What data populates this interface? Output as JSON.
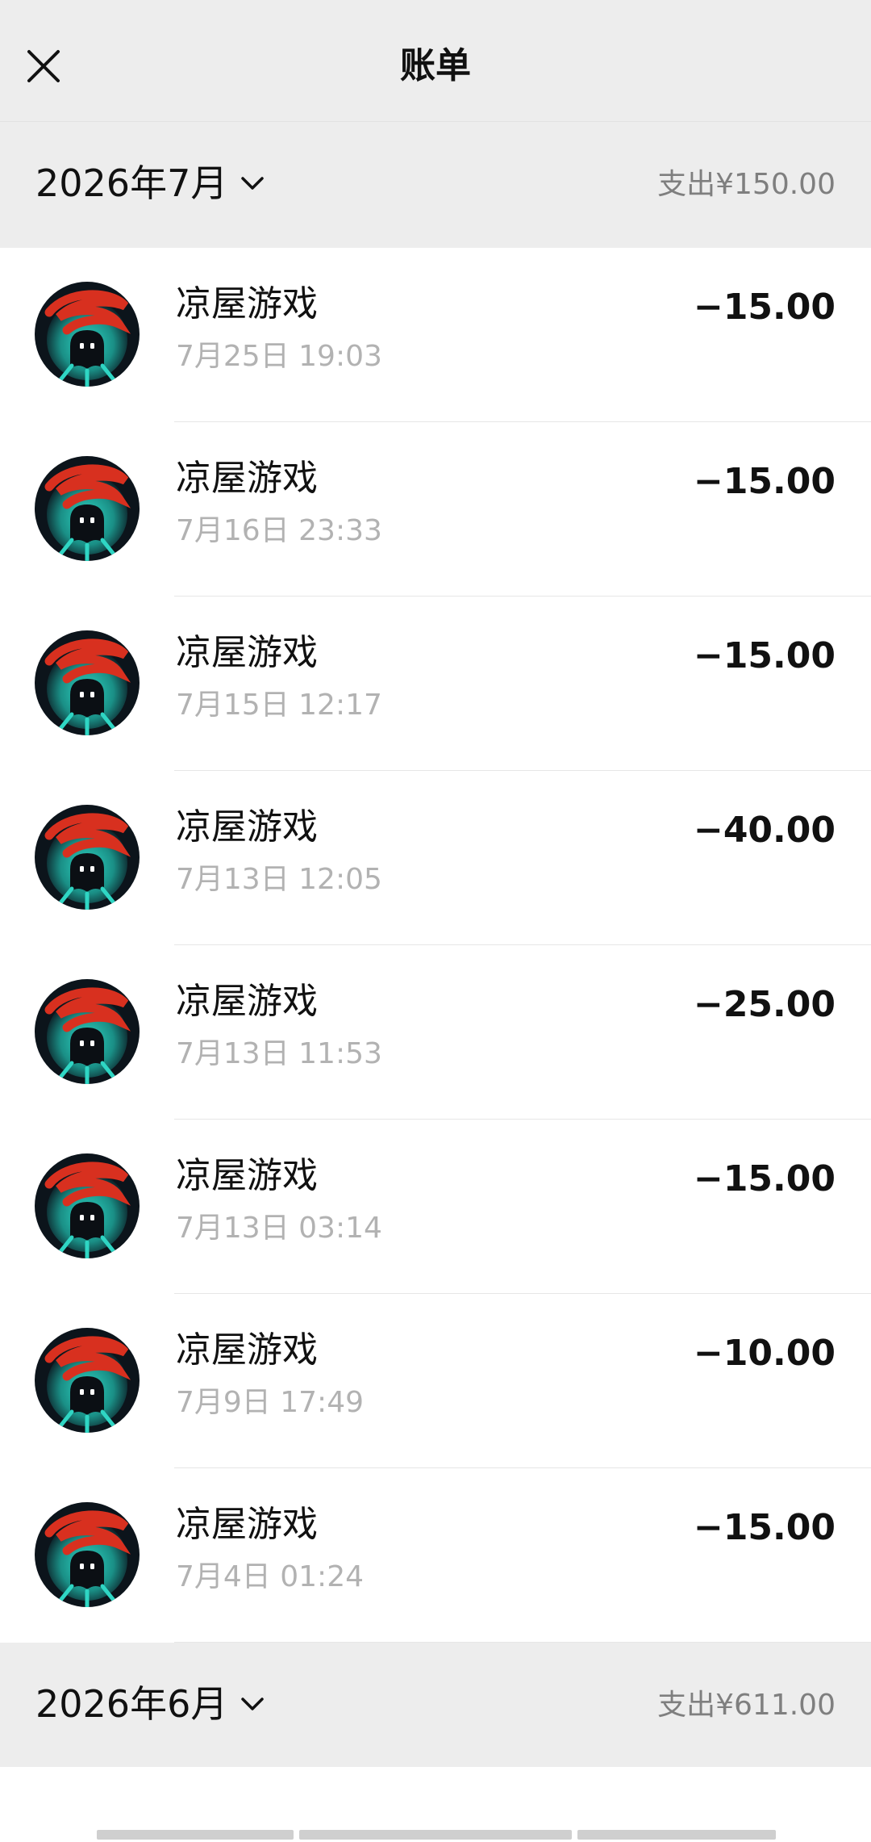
{
  "header": {
    "title": "账单",
    "close_icon": "close-icon"
  },
  "months": [
    {
      "label": "2026年7月",
      "summary": "支出¥150.00"
    },
    {
      "label": "2026年6月",
      "summary": "支出¥611.00"
    }
  ],
  "transactions": [
    {
      "name": "凉屋游戏",
      "time": "7月25日 19:03",
      "amount": "−15.00"
    },
    {
      "name": "凉屋游戏",
      "time": "7月16日 23:33",
      "amount": "−15.00"
    },
    {
      "name": "凉屋游戏",
      "time": "7月15日 12:17",
      "amount": "−15.00"
    },
    {
      "name": "凉屋游戏",
      "time": "7月13日 12:05",
      "amount": "−40.00"
    },
    {
      "name": "凉屋游戏",
      "time": "7月13日 11:53",
      "amount": "−25.00"
    },
    {
      "name": "凉屋游戏",
      "time": "7月13日 03:14",
      "amount": "−15.00"
    },
    {
      "name": "凉屋游戏",
      "time": "7月9日 17:49",
      "amount": "−10.00"
    },
    {
      "name": "凉屋游戏",
      "time": "7月4日 01:24",
      "amount": "−15.00"
    }
  ],
  "colors": {
    "header_bg": "#ededed",
    "muted_text": "#7f7f7f",
    "time_text": "#b2b2b2",
    "avatar_teal": "#21c2b3",
    "avatar_red": "#d8301f"
  }
}
